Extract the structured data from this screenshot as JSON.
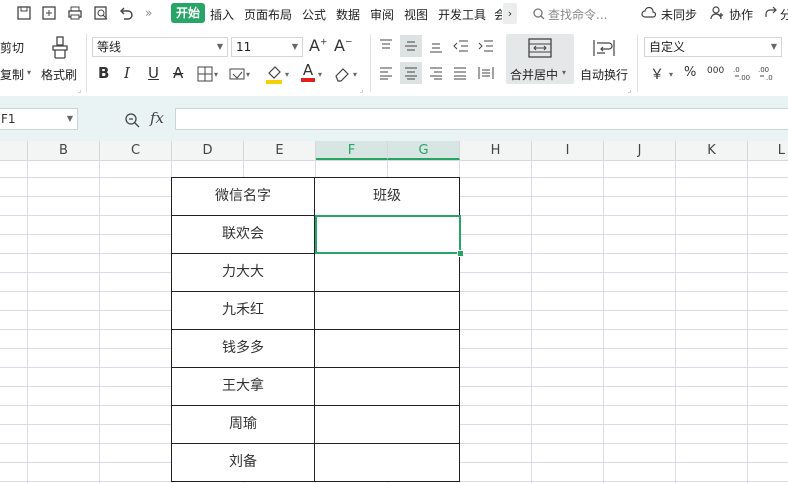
{
  "menubar": {
    "tabs": [
      "开始",
      "插入",
      "页面布局",
      "公式",
      "数据",
      "审阅",
      "视图",
      "开发工具",
      "会"
    ],
    "more": "»",
    "search_placeholder": "查找命令...",
    "sync": "未同步",
    "collab": "协作",
    "share": "分"
  },
  "ribbon": {
    "cut": "剪切",
    "copy": "复制",
    "format_painter": "格式刷",
    "font_name": "等线",
    "font_size": "11",
    "merge_center": "合并居中",
    "wrap_text": "自动换行",
    "number_format": "自定义",
    "currency": "￥",
    "percent": "%",
    "thousands": "000"
  },
  "formula_bar": {
    "name_box": "F1",
    "fx": "fx",
    "formula": ""
  },
  "columns": [
    "B",
    "C",
    "D",
    "E",
    "F",
    "G",
    "H",
    "I",
    "J",
    "K",
    "L"
  ],
  "table": {
    "headers": [
      "微信名字",
      "班级"
    ],
    "rows": [
      [
        "联欢会",
        ""
      ],
      [
        "力大大",
        ""
      ],
      [
        "九禾红",
        ""
      ],
      [
        "钱多多",
        ""
      ],
      [
        "王大拿",
        ""
      ],
      [
        "周瑜",
        ""
      ],
      [
        "刘备",
        ""
      ]
    ]
  },
  "colors": {
    "accent": "#27a567",
    "formula_bar_bg": "#e9f3f3"
  }
}
